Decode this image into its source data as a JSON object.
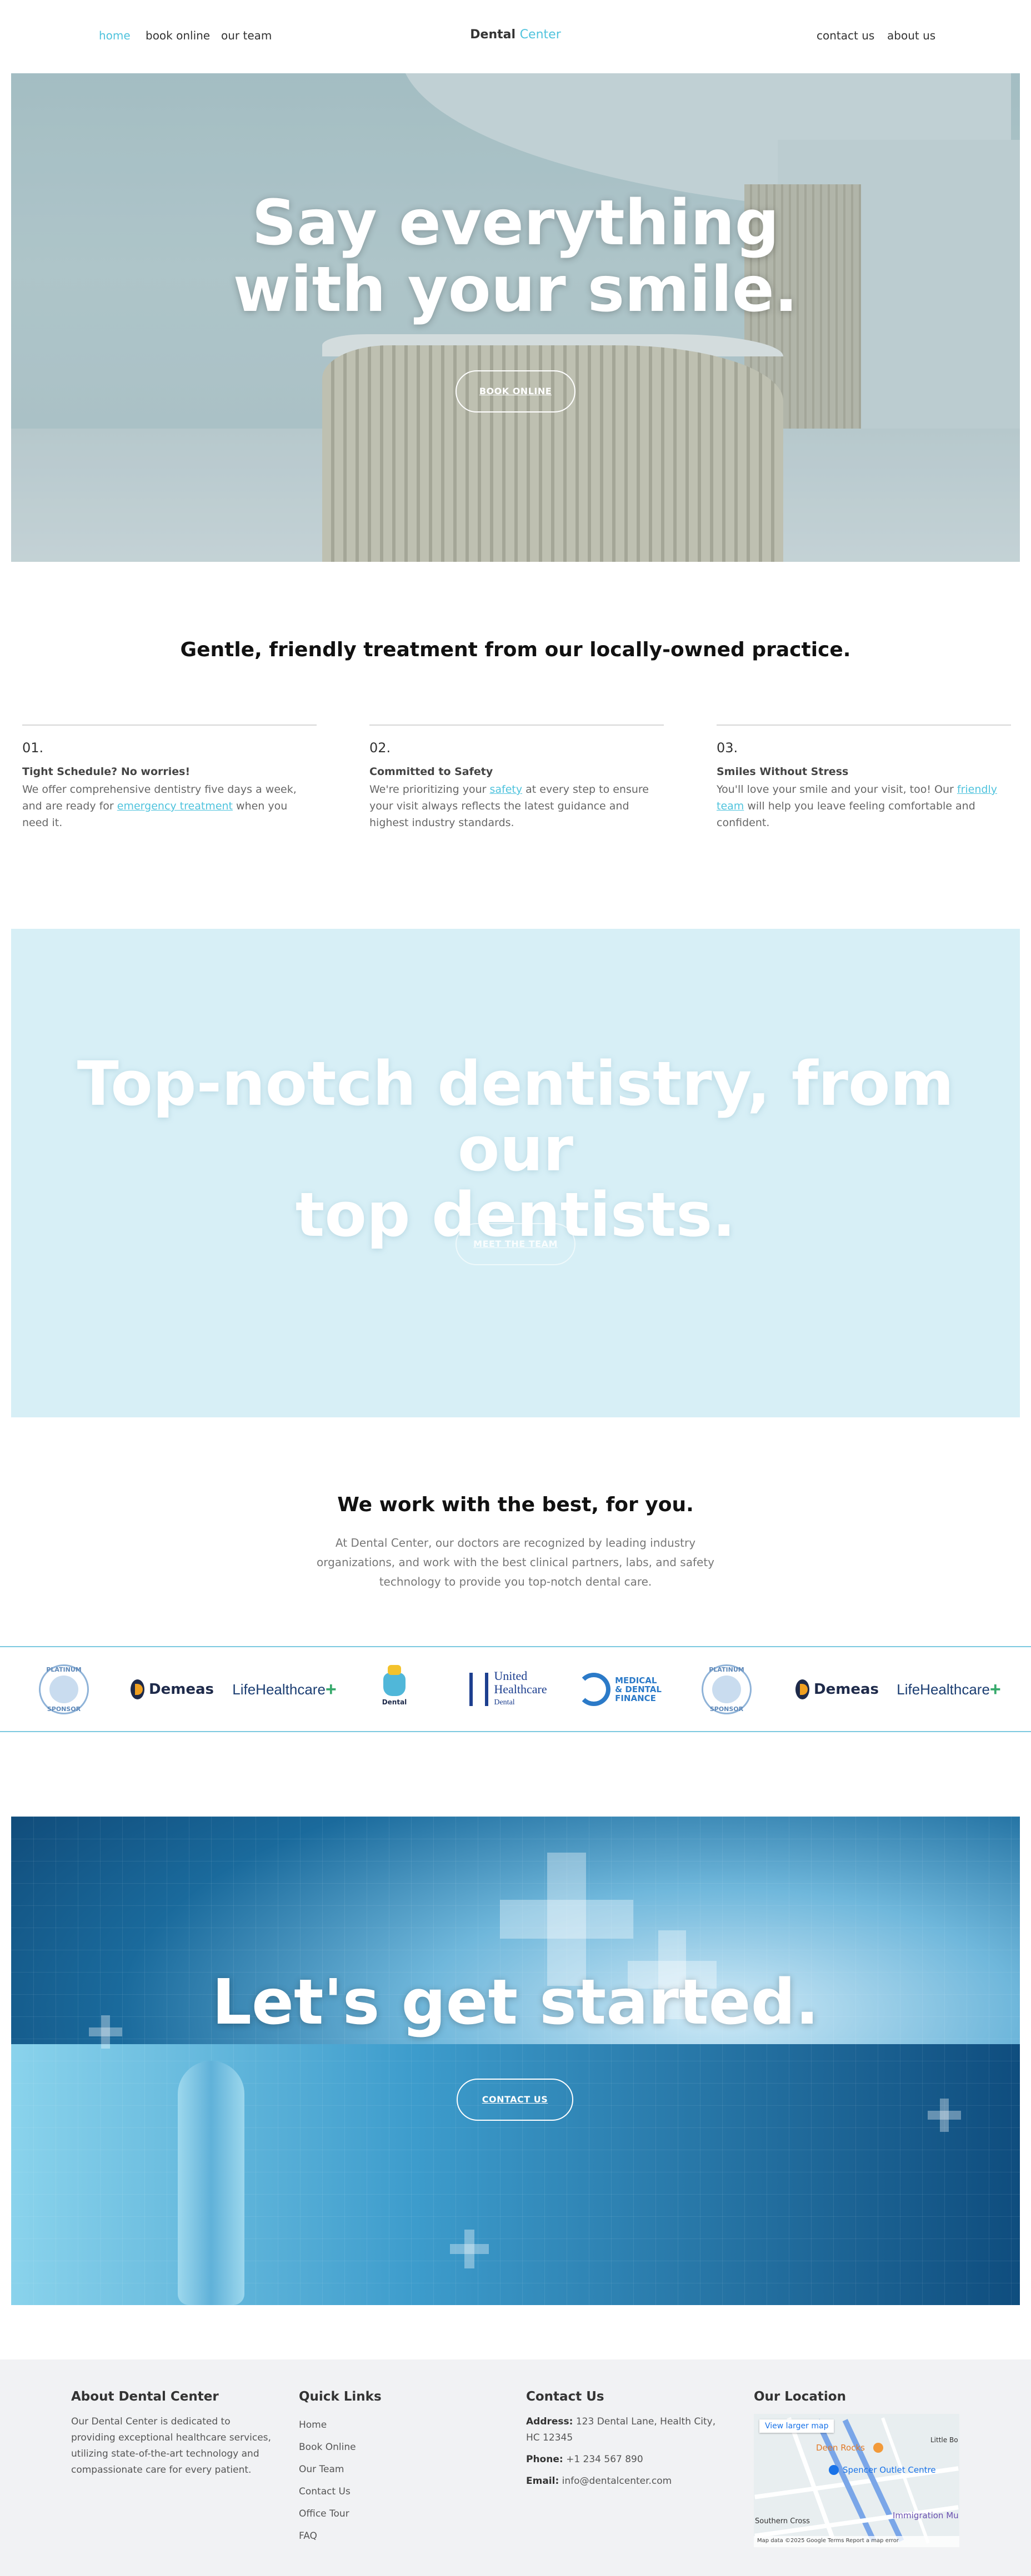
{
  "nav": {
    "left": [
      "home",
      "book online",
      "our team"
    ],
    "right": [
      "contact us",
      "about us"
    ],
    "brand_main": "Dental",
    "brand_accent": "Center",
    "accent_color": "#4fc3dd"
  },
  "hero": {
    "title_line1": "Say everything",
    "title_line2": "with your smile.",
    "button": "BOOK ONLINE"
  },
  "gentle": {
    "title": "Gentle, friendly treatment from our locally-owned practice.",
    "features": [
      {
        "num": "01.",
        "title": "Tight Schedule? No worries!",
        "text_before": "We offer comprehensive dentistry five days a week, and are ready for ",
        "link": "emergency treatment",
        "text_after": " when you need it."
      },
      {
        "num": "02.",
        "title": "Committed to Safety",
        "text_before": "We're prioritizing your ",
        "link": "safety",
        "text_after": " at every step to ensure your visit always reflects the latest guidance and highest industry standards."
      },
      {
        "num": "03.",
        "title": "Smiles Without Stress",
        "text_before": "You'll love your smile and your visit, too! Our ",
        "link": "friendly team",
        "text_after": " will help you leave feeling comfortable and confident."
      }
    ]
  },
  "dentists": {
    "title_line1": "Top-notch dentistry, from our",
    "title_line2": "top dentists.",
    "button": "MEET THE TEAM"
  },
  "partners": {
    "title": "We work with the best, for you.",
    "text": "At Dental Center, our doctors are recognized by leading industry organizations, and work with the best clinical partners, labs, and safety technology to provide you top-notch dental care.",
    "logos": {
      "seal_top": "PLATINUM",
      "seal_bottom": "SPONSOR",
      "demeas": "Demeas",
      "lifehealthcare": "LifeHealthcare",
      "dental": "Dental",
      "uh_line1": "United",
      "uh_line2": "Healthcare",
      "uh_line3": "Dental",
      "js_line1": "MEDICAL",
      "js_line2": "& DENTAL",
      "js_line3": "FINANCE"
    }
  },
  "started": {
    "title": "Let's get started.",
    "button": "CONTACT US"
  },
  "footer": {
    "about": {
      "heading": "About Dental Center",
      "text": "Our Dental Center is dedicated to providing exceptional healthcare services, utilizing state-of-the-art technology and compassionate care for every patient."
    },
    "links": {
      "heading": "Quick Links",
      "items": [
        "Home",
        "Book Online",
        "Our Team",
        "Contact Us",
        "Office Tour",
        "FAQ"
      ]
    },
    "contact": {
      "heading": "Contact Us",
      "address_label": "Address:",
      "address": "123 Dental Lane, Health City, HC 12345",
      "phone_label": "Phone:",
      "phone": "+1 234 567 890",
      "email_label": "Email:",
      "email": "info@dentalcenter.com"
    },
    "location": {
      "heading": "Our Location",
      "map_button": "View larger map",
      "labels": [
        "Deen Rocks",
        "Spencer Outlet Centre",
        "Immigration Mu",
        "Southern Cross",
        "Little Bo"
      ],
      "map_footer": "Map data ©2025 Google   Terms   Report a map error"
    }
  }
}
